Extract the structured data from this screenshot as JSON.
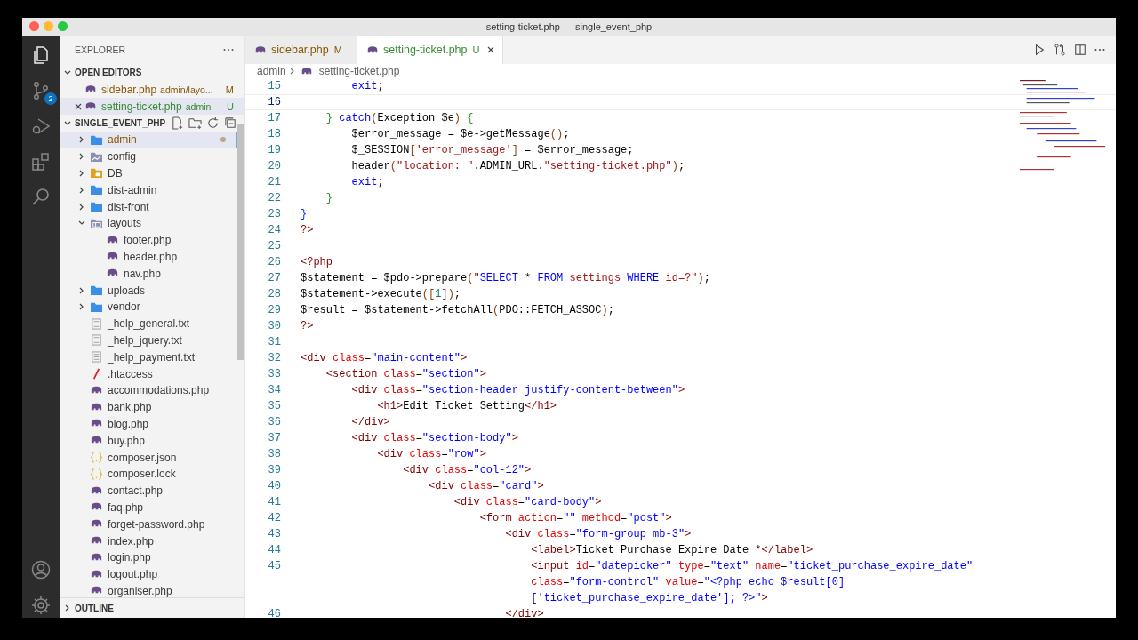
{
  "window": {
    "title": "setting-ticket.php — single_event_php"
  },
  "activity_bar": {
    "source_control_badge": "2"
  },
  "explorer": {
    "title": "EXPLORER",
    "open_editors_title": "OPEN EDITORS",
    "open_editors": [
      {
        "name": "sidebar.php",
        "path": "admin/layo...",
        "badge": "M",
        "kind": "modified",
        "selected": false
      },
      {
        "name": "setting-ticket.php",
        "path": "admin",
        "badge": "U",
        "kind": "untracked",
        "selected": true
      }
    ],
    "project_title": "SINGLE_EVENT_PHP",
    "tree": [
      {
        "name": "admin",
        "kind": "folder",
        "expanded": false,
        "selected": true,
        "modified": true
      },
      {
        "name": "config",
        "kind": "config-folder",
        "expanded": false,
        "selected": false,
        "modified": false
      },
      {
        "name": "DB",
        "kind": "db-folder",
        "expanded": false,
        "selected": false,
        "modified": false
      },
      {
        "name": "dist-admin",
        "kind": "folder",
        "expanded": false,
        "selected": false,
        "modified": false
      },
      {
        "name": "dist-front",
        "kind": "folder",
        "expanded": false,
        "selected": false,
        "modified": false
      },
      {
        "name": "layouts",
        "kind": "layout-folder",
        "expanded": true,
        "selected": false,
        "modified": false,
        "children": [
          {
            "name": "footer.php",
            "kind": "php",
            "selected": false,
            "modified": false
          },
          {
            "name": "header.php",
            "kind": "php",
            "selected": false,
            "modified": false
          },
          {
            "name": "nav.php",
            "kind": "php",
            "selected": false,
            "modified": false
          }
        ]
      },
      {
        "name": "uploads",
        "kind": "folder",
        "expanded": false,
        "selected": false,
        "modified": false
      },
      {
        "name": "vendor",
        "kind": "folder",
        "expanded": false,
        "selected": false,
        "modified": false
      },
      {
        "name": "_help_general.txt",
        "kind": "txt",
        "selected": false,
        "modified": false
      },
      {
        "name": "_help_jquery.txt",
        "kind": "txt",
        "selected": false,
        "modified": false
      },
      {
        "name": "_help_payment.txt",
        "kind": "txt",
        "selected": false,
        "modified": false
      },
      {
        "name": ".htaccess",
        "kind": "htaccess",
        "selected": false,
        "modified": false
      },
      {
        "name": "accommodations.php",
        "kind": "php",
        "selected": false,
        "modified": false
      },
      {
        "name": "bank.php",
        "kind": "php",
        "selected": false,
        "modified": false
      },
      {
        "name": "blog.php",
        "kind": "php",
        "selected": false,
        "modified": false
      },
      {
        "name": "buy.php",
        "kind": "php",
        "selected": false,
        "modified": false
      },
      {
        "name": "composer.json",
        "kind": "json",
        "selected": false,
        "modified": false
      },
      {
        "name": "composer.lock",
        "kind": "json",
        "selected": false,
        "modified": false
      },
      {
        "name": "contact.php",
        "kind": "php",
        "selected": false,
        "modified": false
      },
      {
        "name": "faq.php",
        "kind": "php",
        "selected": false,
        "modified": false
      },
      {
        "name": "forget-password.php",
        "kind": "php",
        "selected": false,
        "modified": false
      },
      {
        "name": "index.php",
        "kind": "php",
        "selected": false,
        "modified": false
      },
      {
        "name": "login.php",
        "kind": "php",
        "selected": false,
        "modified": false
      },
      {
        "name": "logout.php",
        "kind": "php",
        "selected": false,
        "modified": false
      },
      {
        "name": "organiser.php",
        "kind": "php",
        "selected": false,
        "modified": false
      }
    ],
    "outline_title": "OUTLINE"
  },
  "tabs": [
    {
      "label": "sidebar.php",
      "badge": "M",
      "kind": "modified",
      "selected": false
    },
    {
      "label": "setting-ticket.php",
      "badge": "U",
      "kind": "untracked",
      "selected": true
    }
  ],
  "breadcrumb": [
    "admin",
    "setting-ticket.php"
  ],
  "code_lines": [
    {
      "number": "15",
      "current": false,
      "tokens": [
        {
          "kind": "keyword",
          "t": "        exit"
        },
        {
          "kind": "plain",
          "t": ";"
        }
      ]
    },
    {
      "number": "16",
      "current": true
    },
    {
      "number": "17",
      "current": false,
      "tokens": [
        {
          "kind": "brace",
          "t": "    }"
        },
        {
          "kind": "keyword",
          "t": " catch"
        },
        {
          "kind": "paren",
          "t": "("
        },
        {
          "kind": "plain",
          "t": "Exception $e"
        },
        {
          "kind": "paren",
          "t": ")"
        },
        {
          "kind": "brace",
          "t": " {"
        }
      ]
    },
    {
      "number": "18",
      "current": false,
      "tokens": [
        {
          "kind": "plain",
          "t": "        $error_message = $e->getMessage"
        },
        {
          "kind": "paren",
          "t": "()"
        },
        {
          "kind": "plain",
          "t": ";"
        }
      ]
    },
    {
      "number": "19",
      "current": false,
      "tokens": [
        {
          "kind": "plain",
          "t": "        $_SESSION"
        },
        {
          "kind": "paren",
          "t": "["
        },
        {
          "kind": "string",
          "t": "'error_message'"
        },
        {
          "kind": "paren",
          "t": "]"
        },
        {
          "kind": "plain",
          "t": " = $error_message;"
        }
      ]
    },
    {
      "number": "20",
      "current": false,
      "tokens": [
        {
          "kind": "plain",
          "t": "        header"
        },
        {
          "kind": "paren",
          "t": "("
        },
        {
          "kind": "string",
          "t": "\"location: \""
        },
        {
          "kind": "plain",
          "t": ".ADMIN_URL."
        },
        {
          "kind": "string",
          "t": "\"setting-ticket.php\""
        },
        {
          "kind": "paren",
          "t": ")"
        },
        {
          "kind": "plain",
          "t": ";"
        }
      ]
    },
    {
      "number": "21",
      "current": false,
      "tokens": [
        {
          "kind": "keyword",
          "t": "        exit"
        },
        {
          "kind": "plain",
          "t": ";"
        }
      ]
    },
    {
      "number": "22",
      "current": false,
      "tokens": [
        {
          "kind": "brace",
          "t": "    }"
        }
      ]
    },
    {
      "number": "23",
      "current": false,
      "tokens": [
        {
          "kind": "outer-brace",
          "t": "}"
        }
      ]
    },
    {
      "number": "24",
      "current": false,
      "tokens": [
        {
          "kind": "php",
          "t": "?>"
        }
      ]
    },
    {
      "number": "25",
      "current": false
    },
    {
      "number": "26",
      "current": false,
      "tokens": [
        {
          "kind": "php",
          "t": "<?php"
        }
      ]
    },
    {
      "number": "27",
      "current": false,
      "tokens": [
        {
          "kind": "plain",
          "t": "$statement = $pdo->prepare"
        },
        {
          "kind": "paren",
          "t": "("
        },
        {
          "kind": "string",
          "t": "\""
        },
        {
          "kind": "keyword",
          "t": "SELECT"
        },
        {
          "kind": "plain",
          "t": " * "
        },
        {
          "kind": "keyword",
          "t": "FROM"
        },
        {
          "kind": "string",
          "t": " settings "
        },
        {
          "kind": "keyword",
          "t": "WHERE"
        },
        {
          "kind": "string",
          "t": " id=?\""
        },
        {
          "kind": "paren",
          "t": ")"
        },
        {
          "kind": "plain",
          "t": ";"
        }
      ]
    },
    {
      "number": "28",
      "current": false,
      "tokens": [
        {
          "kind": "plain",
          "t": "$statement->execute"
        },
        {
          "kind": "paren",
          "t": "(["
        },
        {
          "kind": "number",
          "t": "1"
        },
        {
          "kind": "paren",
          "t": "])"
        },
        {
          "kind": "plain",
          "t": ";"
        }
      ]
    },
    {
      "number": "29",
      "current": false,
      "tokens": [
        {
          "kind": "plain",
          "t": "$result = $statement->fetchAll"
        },
        {
          "kind": "paren",
          "t": "("
        },
        {
          "kind": "plain",
          "t": "PDO::FETCH_ASSOC"
        },
        {
          "kind": "paren",
          "t": ")"
        },
        {
          "kind": "plain",
          "t": ";"
        }
      ]
    },
    {
      "number": "30",
      "current": false,
      "tokens": [
        {
          "kind": "php",
          "t": "?>"
        }
      ]
    },
    {
      "number": "31",
      "current": false
    },
    {
      "number": "32",
      "current": false,
      "tokens": [
        {
          "kind": "tag",
          "t": "<div"
        },
        {
          "kind": "attr",
          "t": " class"
        },
        {
          "kind": "plain",
          "t": "="
        },
        {
          "kind": "value",
          "t": "\"main-content\""
        },
        {
          "kind": "tag",
          "t": ">"
        }
      ]
    },
    {
      "number": "33",
      "current": false,
      "tokens": [
        {
          "kind": "tag",
          "t": "    <section"
        },
        {
          "kind": "attr",
          "t": " class"
        },
        {
          "kind": "plain",
          "t": "="
        },
        {
          "kind": "value",
          "t": "\"section\""
        },
        {
          "kind": "tag",
          "t": ">"
        }
      ]
    },
    {
      "number": "34",
      "current": false,
      "tokens": [
        {
          "kind": "tag",
          "t": "        <div"
        },
        {
          "kind": "attr",
          "t": " class"
        },
        {
          "kind": "plain",
          "t": "="
        },
        {
          "kind": "value",
          "t": "\"section-header justify-content-between\""
        },
        {
          "kind": "tag",
          "t": ">"
        }
      ]
    },
    {
      "number": "35",
      "current": false,
      "tokens": [
        {
          "kind": "tag",
          "t": "            <h1>"
        },
        {
          "kind": "plain",
          "t": "Edit Ticket Setting"
        },
        {
          "kind": "tag",
          "t": "</h1>"
        }
      ]
    },
    {
      "number": "36",
      "current": false,
      "tokens": [
        {
          "kind": "tag",
          "t": "        </div>"
        }
      ]
    },
    {
      "number": "37",
      "current": false,
      "tokens": [
        {
          "kind": "tag",
          "t": "        <div"
        },
        {
          "kind": "attr",
          "t": " class"
        },
        {
          "kind": "plain",
          "t": "="
        },
        {
          "kind": "value",
          "t": "\"section-body\""
        },
        {
          "kind": "tag",
          "t": ">"
        }
      ]
    },
    {
      "number": "38",
      "current": false,
      "tokens": [
        {
          "kind": "tag",
          "t": "            <div"
        },
        {
          "kind": "attr",
          "t": " class"
        },
        {
          "kind": "plain",
          "t": "="
        },
        {
          "kind": "value",
          "t": "\"row\""
        },
        {
          "kind": "tag",
          "t": ">"
        }
      ]
    },
    {
      "number": "39",
      "current": false,
      "tokens": [
        {
          "kind": "tag",
          "t": "                <div"
        },
        {
          "kind": "attr",
          "t": " class"
        },
        {
          "kind": "plain",
          "t": "="
        },
        {
          "kind": "value",
          "t": "\"col-12\""
        },
        {
          "kind": "tag",
          "t": ">"
        }
      ]
    },
    {
      "number": "40",
      "current": false,
      "tokens": [
        {
          "kind": "tag",
          "t": "                    <div"
        },
        {
          "kind": "attr",
          "t": " class"
        },
        {
          "kind": "plain",
          "t": "="
        },
        {
          "kind": "value",
          "t": "\"card\""
        },
        {
          "kind": "tag",
          "t": ">"
        }
      ]
    },
    {
      "number": "41",
      "current": false,
      "tokens": [
        {
          "kind": "tag",
          "t": "                        <div"
        },
        {
          "kind": "attr",
          "t": " class"
        },
        {
          "kind": "plain",
          "t": "="
        },
        {
          "kind": "value",
          "t": "\"card-body\""
        },
        {
          "kind": "tag",
          "t": ">"
        }
      ]
    },
    {
      "number": "42",
      "current": false,
      "tokens": [
        {
          "kind": "tag",
          "t": "                            <form"
        },
        {
          "kind": "attr",
          "t": " action"
        },
        {
          "kind": "plain",
          "t": "="
        },
        {
          "kind": "value",
          "t": "\"\""
        },
        {
          "kind": "attr",
          "t": " method"
        },
        {
          "kind": "plain",
          "t": "="
        },
        {
          "kind": "value",
          "t": "\"post\""
        },
        {
          "kind": "tag",
          "t": ">"
        }
      ]
    },
    {
      "number": "43",
      "current": false,
      "tokens": [
        {
          "kind": "tag",
          "t": "                                <div"
        },
        {
          "kind": "attr",
          "t": " class"
        },
        {
          "kind": "plain",
          "t": "="
        },
        {
          "kind": "value",
          "t": "\"form-group mb-3\""
        },
        {
          "kind": "tag",
          "t": ">"
        }
      ]
    },
    {
      "number": "44",
      "current": false,
      "tokens": [
        {
          "kind": "tag",
          "t": "                                    <label>"
        },
        {
          "kind": "plain",
          "t": "Ticket Purchase Expire Date *"
        },
        {
          "kind": "tag",
          "t": "</label>"
        }
      ]
    },
    {
      "number": "45",
      "current": false,
      "tokens": [
        {
          "kind": "tag",
          "t": "                                    <input"
        },
        {
          "kind": "attr",
          "t": " id"
        },
        {
          "kind": "plain",
          "t": "="
        },
        {
          "kind": "value",
          "t": "\"datepicker\""
        },
        {
          "kind": "attr",
          "t": " type"
        },
        {
          "kind": "plain",
          "t": "="
        },
        {
          "kind": "value",
          "t": "\"text\""
        },
        {
          "kind": "attr",
          "t": " name"
        },
        {
          "kind": "plain",
          "t": "="
        },
        {
          "kind": "value",
          "t": "\"ticket_purchase_expire_date\""
        }
      ],
      "wrap": [
        [
          {
            "kind": "attr",
            "t": "                                    class"
          },
          {
            "kind": "plain",
            "t": "="
          },
          {
            "kind": "value",
            "t": "\"form-control\""
          },
          {
            "kind": "attr",
            "t": " value"
          },
          {
            "kind": "plain",
            "t": "="
          },
          {
            "kind": "value",
            "t": "\"<?php echo $result[0]"
          }
        ],
        [
          {
            "kind": "value",
            "t": "                                    ['ticket_purchase_expire_date']; ?>\""
          },
          {
            "kind": "tag",
            "t": ">"
          }
        ]
      ]
    },
    {
      "number": "46",
      "current": false,
      "tokens": [
        {
          "kind": "tag",
          "t": "                                </div>"
        }
      ]
    }
  ]
}
